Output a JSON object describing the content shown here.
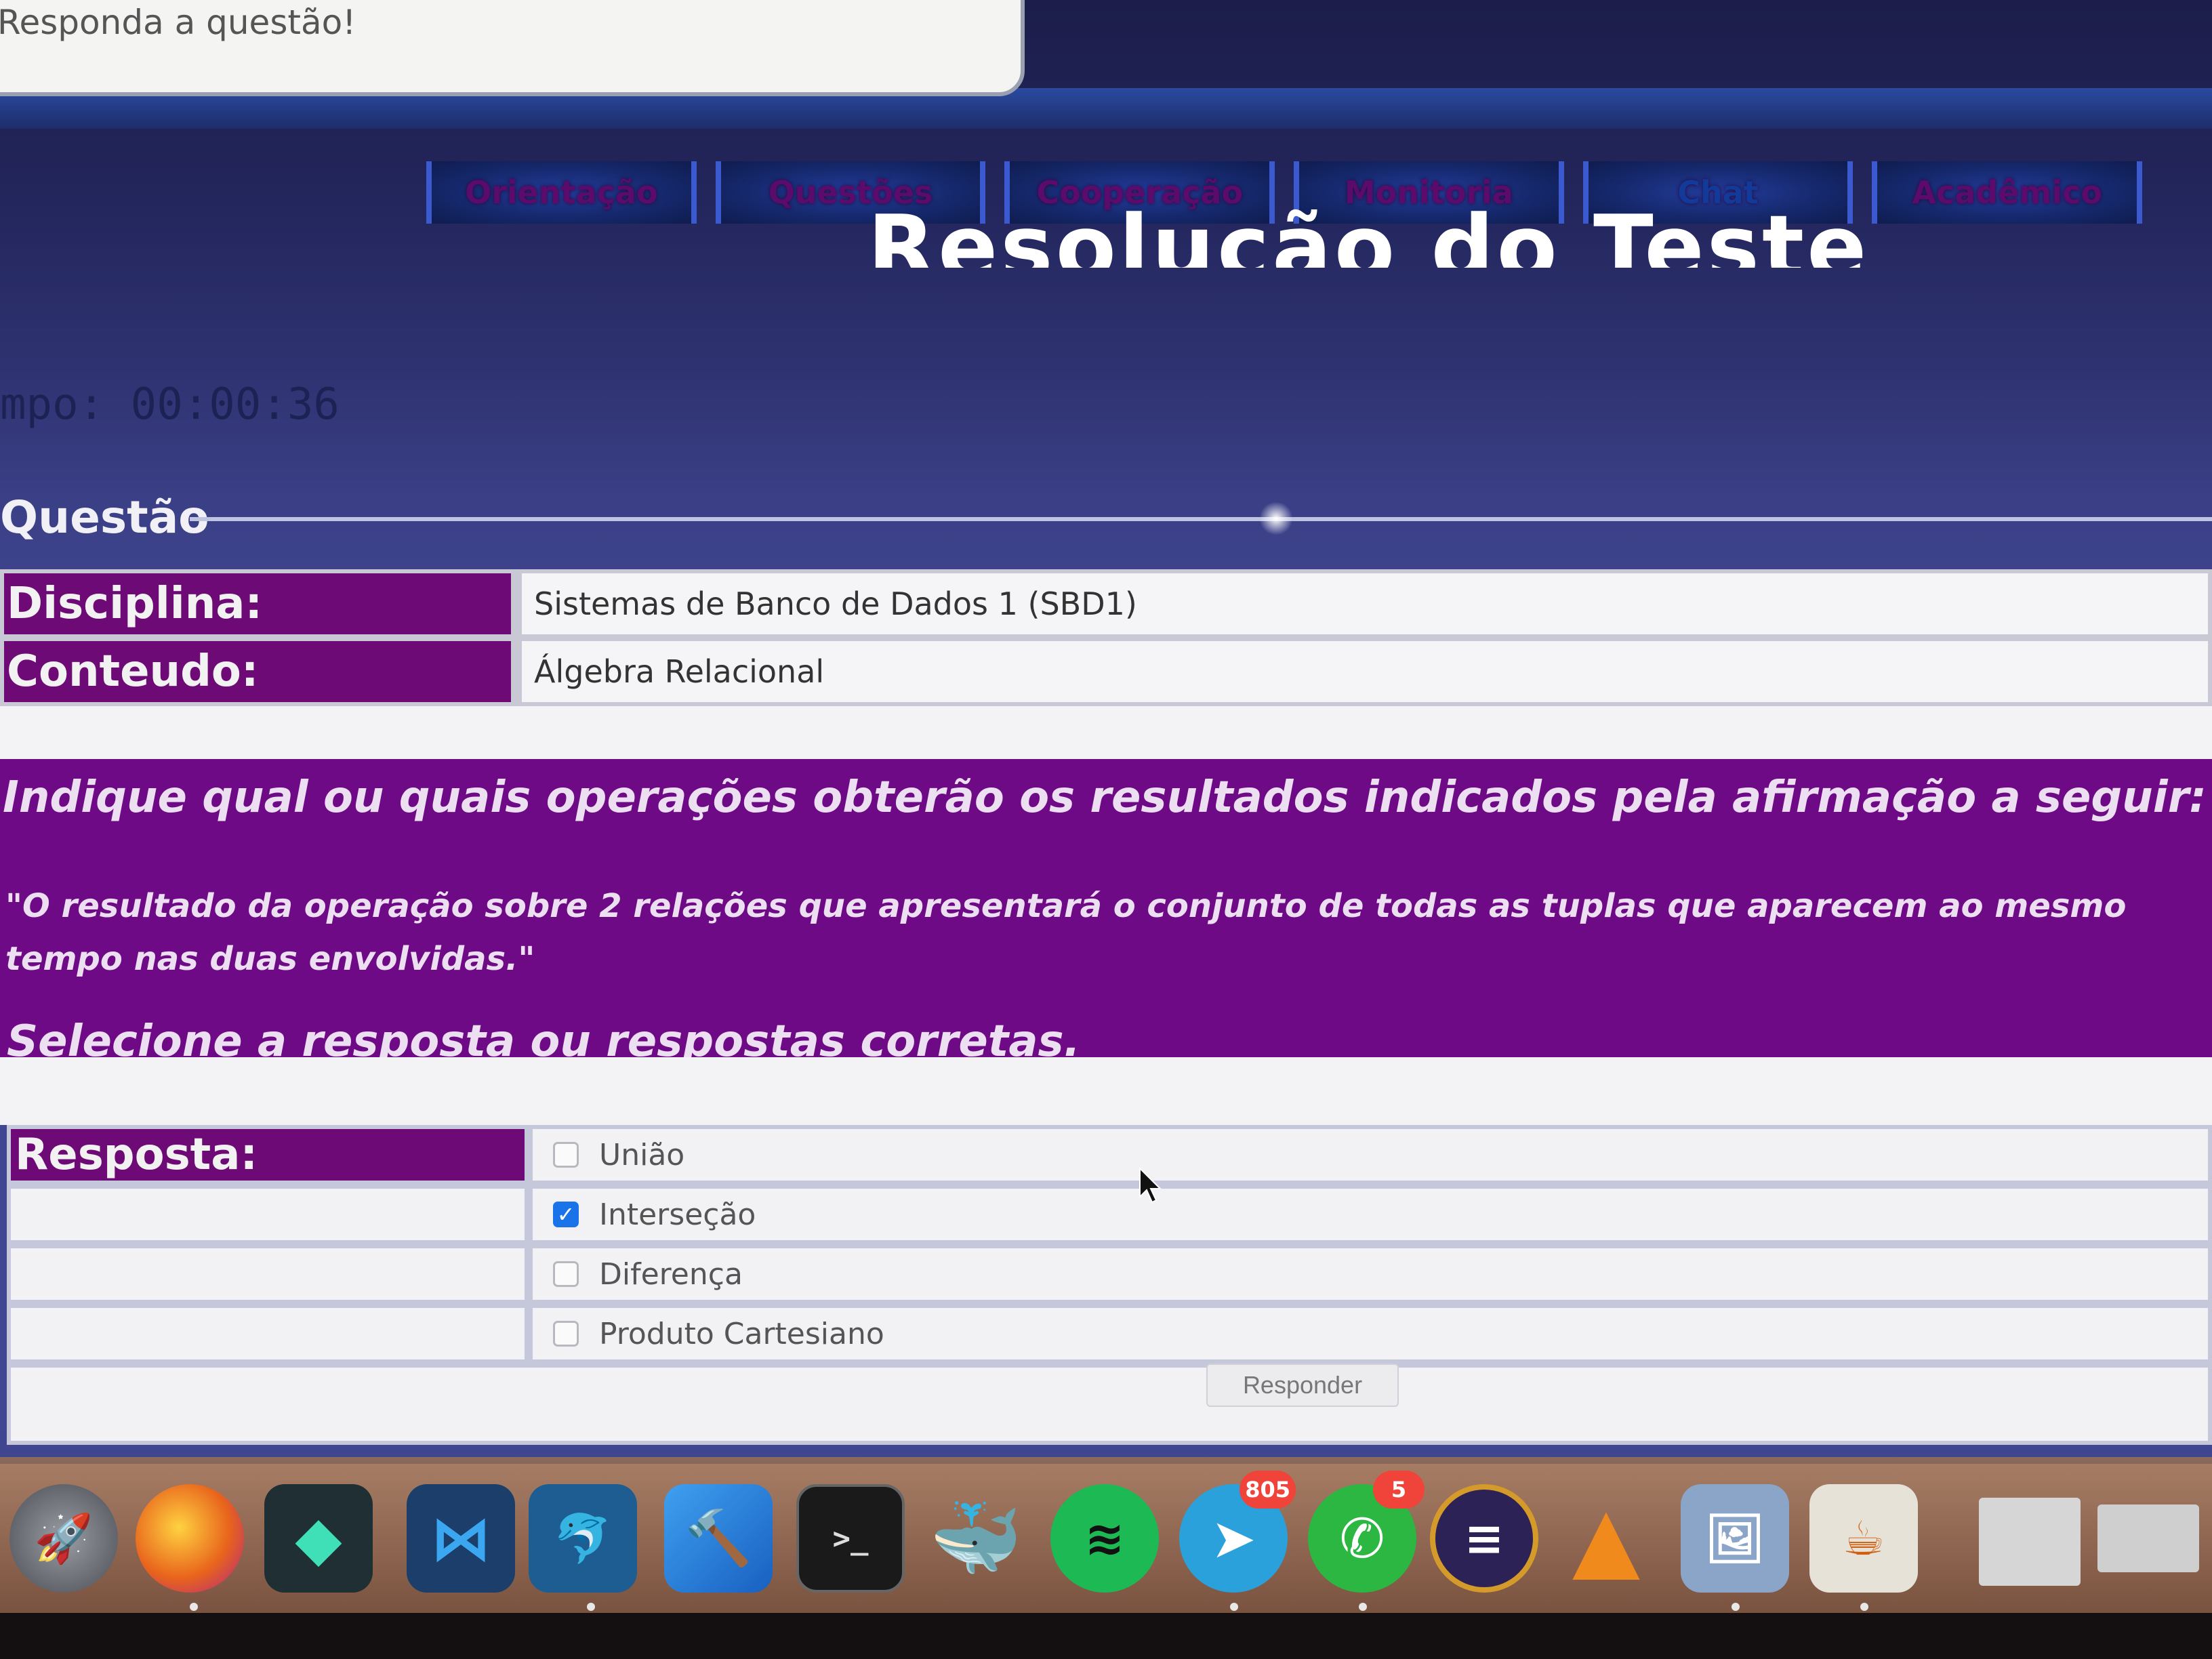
{
  "tooltip": {
    "text": "Responda a questão!"
  },
  "nav": {
    "tabs": [
      "Orientação",
      "Questões",
      "Cooperação",
      "Monitoria",
      "Chat",
      "Acadêmico"
    ]
  },
  "page": {
    "title": "Resolução do Teste",
    "timer": "mpo: 00:00:36"
  },
  "question_panel": {
    "legend": "Questão",
    "discipline_label": "Disciplina:",
    "discipline_value": "Sistemas de Banco de Dados 1 (SBD1)",
    "content_label": "Conteudo:",
    "content_value": "Álgebra Relacional",
    "prompt": "Indique qual ou quais operações obterão os resultados indicados pela afirmação a seguir:",
    "statement": "\"O resultado da operação sobre 2 relações que apresentará o conjunto de todas as tuplas que aparecem ao mesmo tempo nas duas envolvidas.\"",
    "instruction": "Selecione a resposta ou respostas corretas."
  },
  "answer": {
    "label": "Resposta:",
    "options": [
      {
        "label": "União",
        "checked": false
      },
      {
        "label": "Interseção",
        "checked": true
      },
      {
        "label": "Diferença",
        "checked": false
      },
      {
        "label": "Produto Cartesiano",
        "checked": false
      }
    ],
    "submit_label": "Responder"
  },
  "dock": {
    "apps": [
      {
        "name": "launchpad",
        "color": "#5a5d64"
      },
      {
        "name": "firefox",
        "color": "#e8641c"
      },
      {
        "name": "filmora",
        "color": "#1f2f33"
      },
      {
        "name": "vscode",
        "color": "#1f5fa8"
      },
      {
        "name": "mysql-workbench",
        "color": "#1e5d92"
      },
      {
        "name": "xcode",
        "color": "#1b7ad6"
      },
      {
        "name": "terminal",
        "color": "#1a1a1a"
      },
      {
        "name": "docker",
        "color": "#2d8fd8"
      },
      {
        "name": "spotify",
        "color": "#1db954"
      },
      {
        "name": "telegram",
        "color": "#2aa1da",
        "badge": "805"
      },
      {
        "name": "whatsapp",
        "color": "#2bb741",
        "badge": "5"
      },
      {
        "name": "eclipse",
        "color": "#2c2255"
      },
      {
        "name": "vlc",
        "color": "#f08a1c"
      },
      {
        "name": "preview",
        "color": "#8aa5c8"
      },
      {
        "name": "java",
        "color": "#e6e2d8"
      },
      {
        "name": "finder-window",
        "color": "#d6d6d6"
      },
      {
        "name": "vlc-window",
        "color": "#cfcfcf"
      }
    ]
  }
}
